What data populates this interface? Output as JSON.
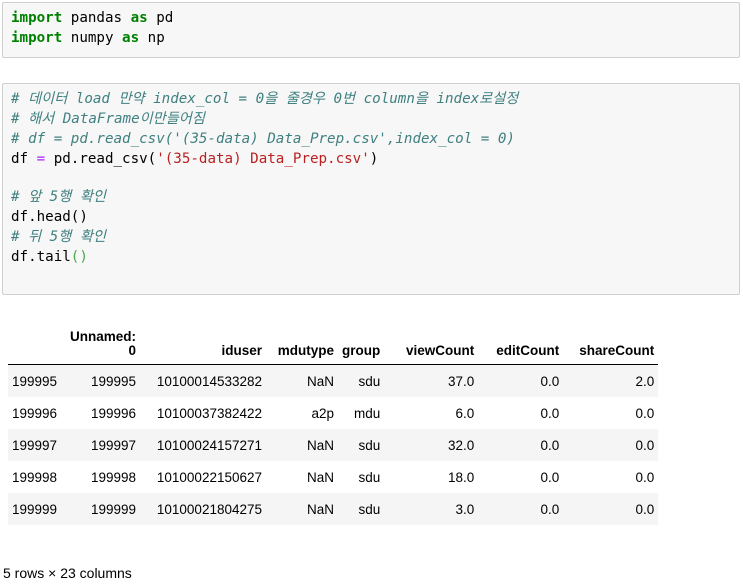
{
  "cell1": {
    "line1": {
      "kw": "import",
      "rest": " pandas ",
      "kw2": "as",
      "rest2": " pd"
    },
    "line2": {
      "kw": "import",
      "rest": " numpy ",
      "kw2": "as",
      "rest2": " np"
    }
  },
  "cell2": {
    "comment1": "# 데이터 load 만약 index_col = 0을 줄경우 0번 column을 index로설정",
    "comment2": "# 해서 DataFrame이만들어짐",
    "comment3": "# df = pd.read_csv('(35-data) Data_Prep.csv',index_col = 0)",
    "code1_a": "df ",
    "code1_op": "=",
    "code1_b": " pd.read_csv(",
    "code1_str": "'(35-data) Data_Prep.csv'",
    "code1_c": ")",
    "comment4": "# 앞 5행 확인",
    "code2": "df.head()",
    "comment5": "# 뒤 5행 확인",
    "code3_a": "df.tail",
    "code3_br": "()"
  },
  "table": {
    "columns": [
      "",
      "Unnamed: 0",
      "iduser",
      "mdutype",
      "group",
      "viewCount",
      "editCount",
      "shareCount"
    ],
    "rows": [
      [
        "199995",
        "199995",
        "10100014533282",
        "NaN",
        "sdu",
        "37.0",
        "0.0",
        "2.0"
      ],
      [
        "199996",
        "199996",
        "10100037382422",
        "a2p",
        "mdu",
        "6.0",
        "0.0",
        "0.0"
      ],
      [
        "199997",
        "199997",
        "10100024157271",
        "NaN",
        "sdu",
        "32.0",
        "0.0",
        "0.0"
      ],
      [
        "199998",
        "199998",
        "10100022150627",
        "NaN",
        "sdu",
        "18.0",
        "0.0",
        "0.0"
      ],
      [
        "199999",
        "199999",
        "10100021804275",
        "NaN",
        "sdu",
        "3.0",
        "0.0",
        "0.0"
      ]
    ]
  },
  "summary": "5 rows × 23 columns"
}
